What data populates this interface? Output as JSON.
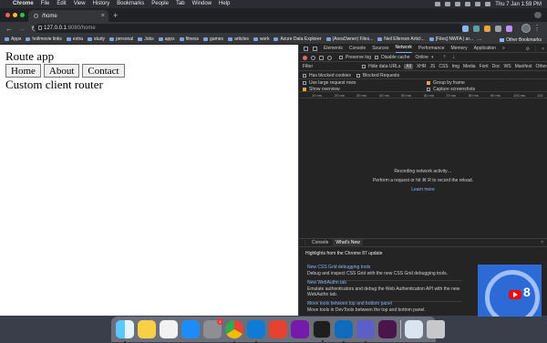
{
  "macos_menubar": {
    "app_name": "Chrome",
    "items": [
      "File",
      "Edit",
      "View",
      "History",
      "Bookmarks",
      "People",
      "Tab",
      "Window",
      "Help"
    ],
    "clock": "Thu 7 Jan  1:59 PM"
  },
  "browser": {
    "tab_title": "/home",
    "url_host": "127.0.0.1",
    "url_path": ":8080/home",
    "bookmarks": [
      "Apps",
      "hollmovie links",
      "extra",
      "study",
      "personal",
      "Jobs",
      "apps",
      "fitness",
      "games",
      "articles",
      "work",
      "Azure Data Explorer",
      "(AreaOwner) Files...",
      "Neil Ellerson Articl...",
      "[Files] NWFA | ar...",
      "..."
    ],
    "other_bookmarks": "Other Bookmarks"
  },
  "app": {
    "title": "Route app",
    "nav_buttons": [
      "Home",
      "About",
      "Contact"
    ],
    "content": "Custom client router"
  },
  "devtools": {
    "tabs": [
      "Elements",
      "Console",
      "Sources",
      "Network",
      "Performance",
      "Memory",
      "Application"
    ],
    "active_tab": "Network",
    "more": "»",
    "toolbar": {
      "preserve_log": "Preserve log",
      "disable_cache": "Disable cache",
      "throttle": "Online"
    },
    "filter": {
      "label": "Filter",
      "hide_data_urls": "Hide data URLs",
      "types": [
        "All",
        "XHR",
        "JS",
        "CSS",
        "Img",
        "Media",
        "Font",
        "Doc",
        "WS",
        "Manifest",
        "Other"
      ],
      "selected_type": "All",
      "has_blocked_cookies": "Has blocked cookies",
      "blocked_requests": "Blocked Requests"
    },
    "options": {
      "large_rows": "Use large request rows",
      "group_by_frame": "Group by frame",
      "show_overview": "Show overview",
      "capture_screenshots": "Capture screenshots"
    },
    "timeline_ticks": [
      "10 ms",
      "20 ms",
      "30 ms",
      "40 ms",
      "50 ms",
      "60 ms",
      "70 ms",
      "80 ms",
      "90 ms",
      "100 ms",
      "110"
    ],
    "recording": {
      "line1": "Recording network activity…",
      "line2": "Perform a request or hit ⌘ R to record the reload.",
      "link": "Learn more"
    },
    "drawer": {
      "tabs": [
        "Console",
        "What's New"
      ],
      "active": "What's New",
      "highlights": "Highlights from the Chrome 87 update",
      "features": [
        {
          "title": "New CSS Grid debugging tools",
          "desc": "Debug and inspect CSS Grid with the new CSS Grid debugging tools."
        },
        {
          "title": "New WebAuthn tab",
          "desc": "Emulate authenticators and debug the Web Authentication API with the new WebAuthn tab."
        },
        {
          "title": "Move tools between top and bottom panel",
          "desc": "Move tools in DevTools between the top and bottom panel."
        }
      ],
      "video_number": "8"
    }
  },
  "dock": {
    "apps": [
      "finder",
      "notes",
      "reminders",
      "app-store",
      "system-preferences",
      "chrome",
      "vscode",
      "todoist",
      "onenote",
      "terminal",
      "outlook",
      "teams",
      "slack",
      "preview",
      "trash"
    ],
    "badge": "1"
  },
  "colors": {
    "record": "#e46962",
    "link": "#8ab4f8",
    "active_tab_underline": "#7cacf8"
  }
}
